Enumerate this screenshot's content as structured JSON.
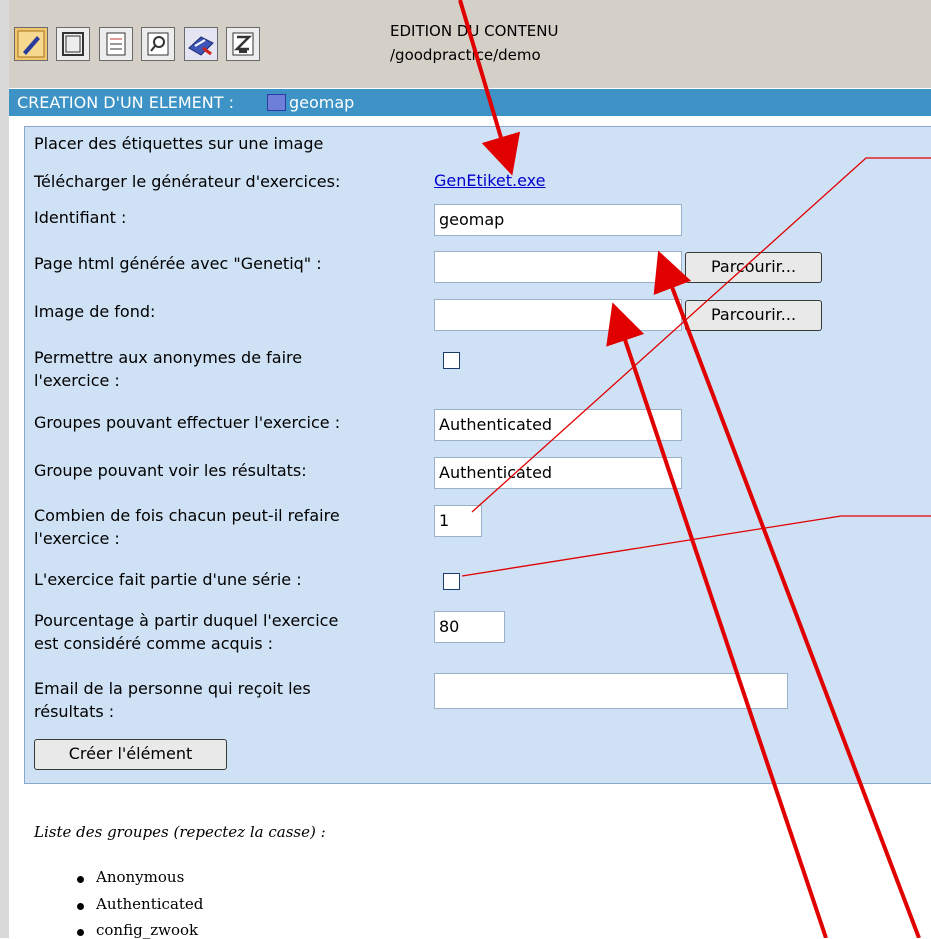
{
  "toolbar": {
    "icons": [
      "edit-icon",
      "frame-icon",
      "list-icon",
      "search-page-icon",
      "publish-icon",
      "zip-icon"
    ],
    "title": "EDITION DU CONTENU",
    "path": "/goodpractice/demo"
  },
  "titlebar": {
    "label": "CREATION D'UN ELEMENT :",
    "element_name": "geomap"
  },
  "form": {
    "heading": "Placer des étiquettes sur une image",
    "download_label": "Télécharger le générateur d'exercices:",
    "download_link": "GenEtiket.exe",
    "identifier_label": "Identifiant :",
    "identifier_value": "geomap",
    "html_page_label": "Page html générée avec \"Genetiq\" :",
    "html_page_value": "",
    "browse_label_1": "Parcourir...",
    "background_image_label": "Image de fond:",
    "background_image_value": "",
    "browse_label_2": "Parcourir...",
    "anonymous_label_line1": "Permettre aux anonymes de faire",
    "anonymous_label_line2": "l'exercice :",
    "groups_do_label": "Groupes pouvant effectuer l'exercice :",
    "groups_do_value": "Authenticated",
    "group_results_label": "Groupe pouvant voir les résultats:",
    "group_results_value": "Authenticated",
    "retries_label_line1": "Combien de fois chacun peut-il refaire",
    "retries_label_line2": "l'exercice :",
    "retries_value": "1",
    "series_label": "L'exercice fait partie d'une série :",
    "percentage_label_line1": "Pourcentage à partir duquel l'exercice",
    "percentage_label_line2": "est considéré comme acquis :",
    "percentage_value": "80",
    "email_label_line1": "Email de la personne qui reçoit les",
    "email_label_line2": "résultats :",
    "email_value": "",
    "submit_label": "Créer l'élément"
  },
  "groups": {
    "title": "Liste des groupes (repectez la casse) :",
    "items": [
      "Anonymous",
      "Authenticated",
      "config_zwook"
    ]
  },
  "annotation_color": "#e00000"
}
